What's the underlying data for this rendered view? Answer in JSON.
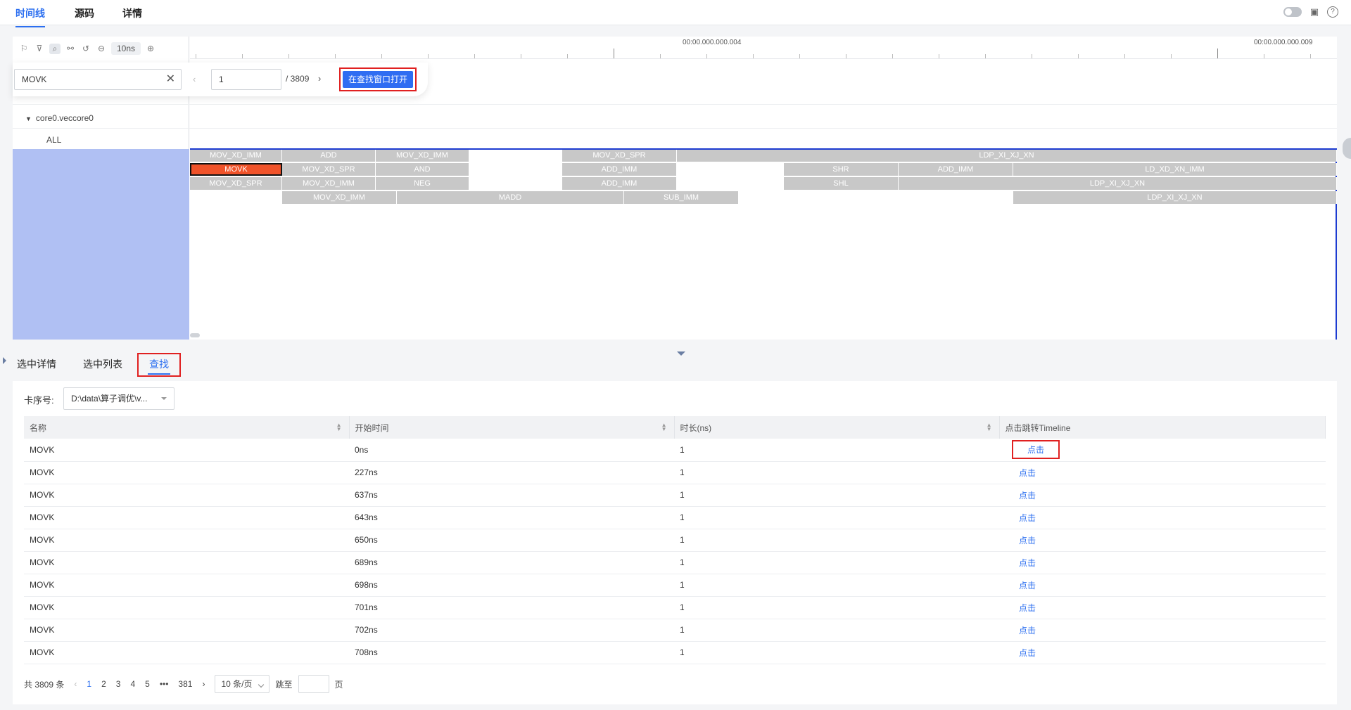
{
  "nav": {
    "tabs": [
      "时间线",
      "源码",
      "详情"
    ]
  },
  "timeline": {
    "zoom": "10ns",
    "ruler_labels": [
      "00:00.000.000.004",
      "00:00.000.000.009"
    ],
    "search": {
      "query": "MOVK",
      "page": "1",
      "total": "/ 3809",
      "open_button": "在查找窗口打开"
    },
    "tree": {
      "core": "core0.veccore0",
      "all": "ALL"
    },
    "rows": [
      [
        "MOV_XD_IMM",
        "ADD",
        "MOV_XD_IMM",
        "MOV_XD_SPR",
        "LDP_XI_XJ_XN"
      ],
      [
        "MOVK",
        "MOV_XD_SPR",
        "AND",
        "ADD_IMM",
        "SHR",
        "ADD_IMM",
        "LD_XD_XN_IMM"
      ],
      [
        "MOV_XD_SPR",
        "MOV_XD_IMM",
        "NEG",
        "ADD_IMM",
        "SHL",
        "LDP_XI_XJ_XN"
      ],
      [
        "MOV_XD_IMM",
        "MADD",
        "SUB_IMM",
        "LDP_XI_XJ_XN"
      ]
    ]
  },
  "bottom": {
    "tabs": [
      "选中详情",
      "选中列表",
      "查找"
    ],
    "card_label": "卡序号:",
    "card_value": "D:\\data\\算子调优\\v...",
    "columns": [
      "名称",
      "开始时间",
      "时长(ns)",
      "点击跳转Timeline"
    ],
    "rows": [
      {
        "name": "MOVK",
        "start": "0ns",
        "dur": "1",
        "link": "点击"
      },
      {
        "name": "MOVK",
        "start": "227ns",
        "dur": "1",
        "link": "点击"
      },
      {
        "name": "MOVK",
        "start": "637ns",
        "dur": "1",
        "link": "点击"
      },
      {
        "name": "MOVK",
        "start": "643ns",
        "dur": "1",
        "link": "点击"
      },
      {
        "name": "MOVK",
        "start": "650ns",
        "dur": "1",
        "link": "点击"
      },
      {
        "name": "MOVK",
        "start": "689ns",
        "dur": "1",
        "link": "点击"
      },
      {
        "name": "MOVK",
        "start": "698ns",
        "dur": "1",
        "link": "点击"
      },
      {
        "name": "MOVK",
        "start": "701ns",
        "dur": "1",
        "link": "点击"
      },
      {
        "name": "MOVK",
        "start": "702ns",
        "dur": "1",
        "link": "点击"
      },
      {
        "name": "MOVK",
        "start": "708ns",
        "dur": "1",
        "link": "点击"
      }
    ],
    "pager": {
      "total": "共 3809 条",
      "pages": [
        "1",
        "2",
        "3",
        "4",
        "5",
        "•••",
        "381"
      ],
      "page_size": "10 条/页",
      "jump_label": "跳至",
      "page_unit": "页"
    }
  }
}
